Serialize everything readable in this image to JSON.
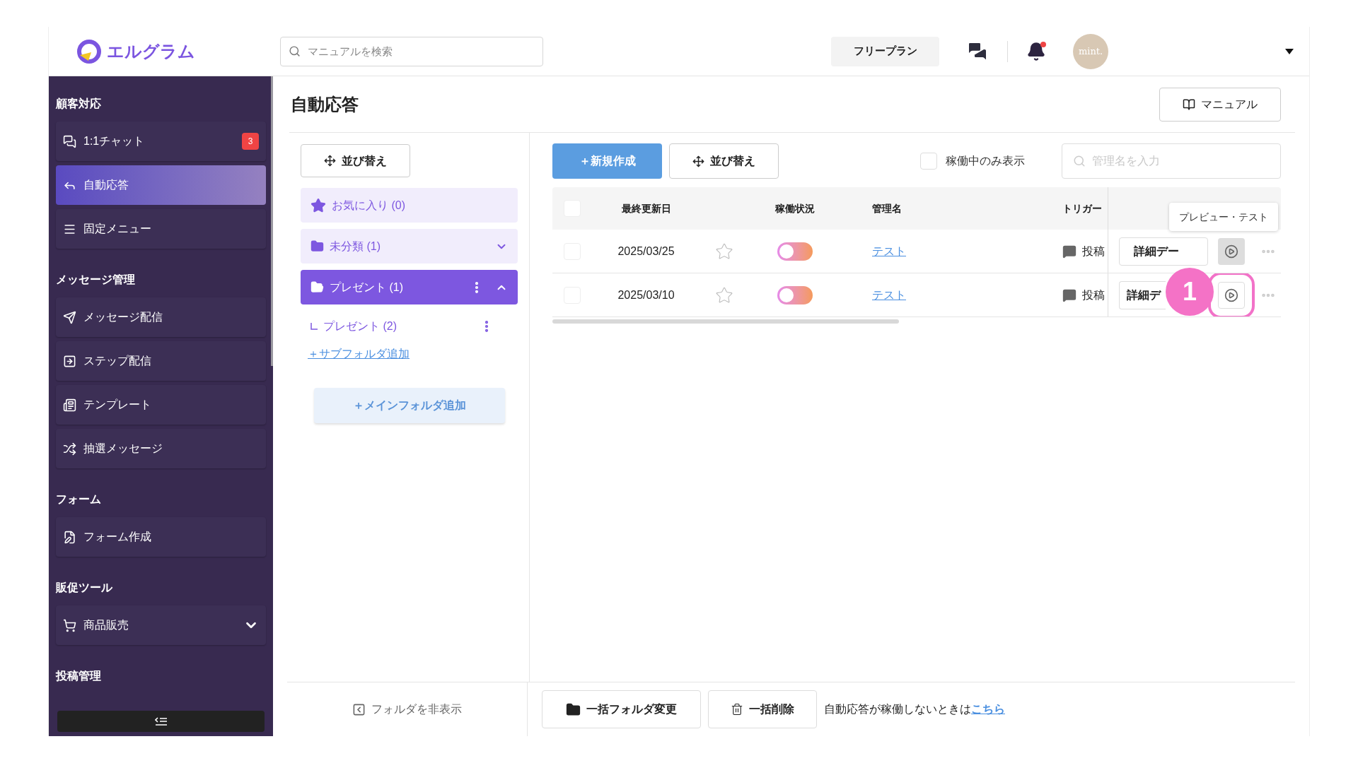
{
  "header": {
    "logo_text": "エルグラム",
    "search": {
      "placeholder": "マニュアルを検索"
    },
    "plan_button": "フリープラン",
    "notification_dot": true,
    "avatar_text": "mint."
  },
  "sidebar": {
    "sections": [
      {
        "title": "顧客対応",
        "items": [
          {
            "label": "1:1チャット",
            "badge": "3",
            "selected": false
          },
          {
            "label": "自動応答",
            "selected": true
          },
          {
            "label": "固定メニュー",
            "selected": false
          }
        ]
      },
      {
        "title": "メッセージ管理",
        "items": [
          {
            "label": "メッセージ配信",
            "selected": false
          },
          {
            "label": "ステップ配信",
            "selected": false
          },
          {
            "label": "テンプレート",
            "selected": false
          },
          {
            "label": "抽選メッセージ",
            "selected": false
          }
        ]
      },
      {
        "title": "フォーム",
        "items": [
          {
            "label": "フォーム作成",
            "selected": false
          }
        ]
      },
      {
        "title": "販促ツール",
        "items": [
          {
            "label": "商品販売",
            "selected": false,
            "expanded": false
          }
        ]
      },
      {
        "title": "投稿管理"
      }
    ]
  },
  "page": {
    "title": "自動応答",
    "manual_button": "マニュアル"
  },
  "folders": {
    "sort_button": "並び替え",
    "items": [
      {
        "kind": "favorites",
        "label": "お気に入り (0)",
        "selected": false
      },
      {
        "kind": "folder",
        "label": "未分類 (1)",
        "selected": false,
        "expanded": false
      },
      {
        "kind": "folder",
        "label": "プレゼント (1)",
        "selected": true,
        "expanded": true,
        "children": [
          {
            "label": "プレゼント (2)"
          }
        ]
      }
    ],
    "add_subfolder": "＋サブフォルダ追加",
    "add_main_folder": "＋メインフォルダ追加",
    "hide_folders": "フォルダを非表示"
  },
  "toolbar": {
    "new_button": "＋新規作成",
    "sort_button": "並び替え",
    "active_only": {
      "label": "稼働中のみ表示",
      "checked": false
    },
    "search": {
      "placeholder": "管理名を入力"
    }
  },
  "table": {
    "select_all_checked": false,
    "columns": [
      "最終更新日",
      "稼働状況",
      "管理名",
      "トリガー"
    ],
    "rows": [
      {
        "checked": false,
        "date": "2025/03/25",
        "starred": false,
        "on": false,
        "name": "テスト",
        "trigger": "投稿",
        "detail_button": "詳細デー",
        "play_highlighted": false
      },
      {
        "checked": false,
        "date": "2025/03/10",
        "starred": false,
        "on": false,
        "name": "テスト",
        "trigger": "投稿",
        "detail_button": "詳細デ",
        "play_highlighted": true
      }
    ],
    "tooltip": "プレビュー・テスト",
    "annotation": "1"
  },
  "bottom": {
    "bulk_folder_button": "一括フォルダ変更",
    "bulk_delete_button": "一括削除",
    "note": "自動応答が稼働しないときは",
    "note_link": "こちら"
  }
}
